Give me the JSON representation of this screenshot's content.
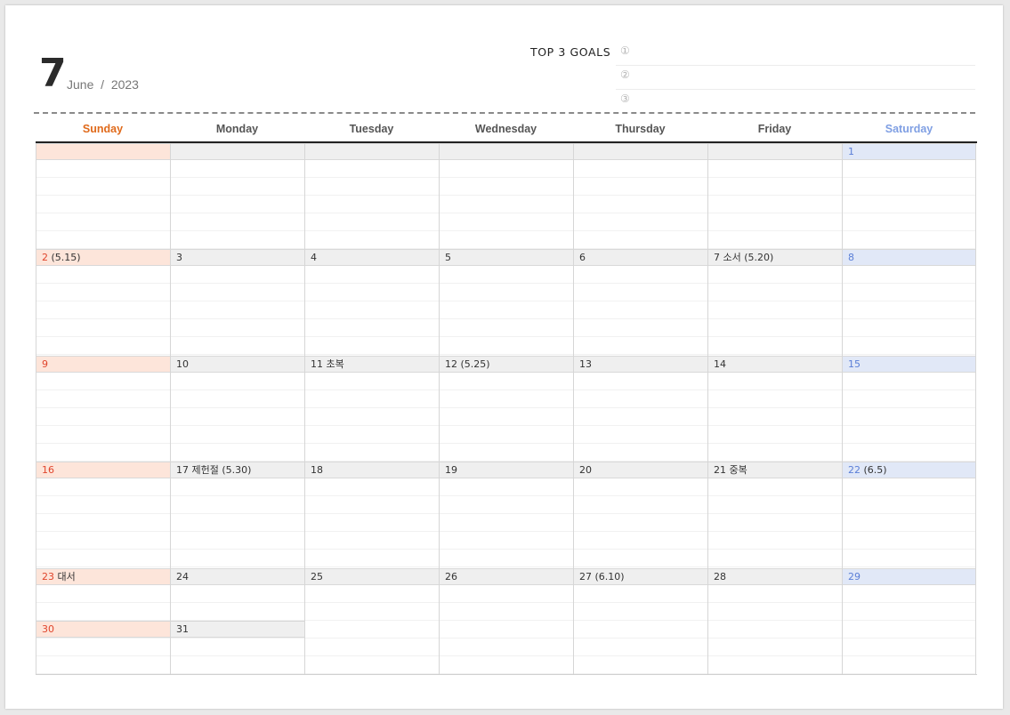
{
  "header": {
    "day_number": "7",
    "month": "June",
    "separator": "/",
    "year": "2023"
  },
  "goals": {
    "title": "TOP 3 GOALS",
    "markers": [
      "①",
      "②",
      "③"
    ]
  },
  "weekdays": [
    "Sunday",
    "Monday",
    "Tuesday",
    "Wednesday",
    "Thursday",
    "Friday",
    "Saturday"
  ],
  "colors": {
    "sunday_accent": "#e06a1b",
    "saturday_accent": "#7f9fe3",
    "holiday_red": "#e0452c",
    "saturday_blue": "#5b7fd7",
    "sunday_bar": "#fde5da",
    "saturday_bar": "#e1e8f7",
    "weekday_bar": "#efefef"
  },
  "weeks": [
    [
      {
        "day": "",
        "note": ""
      },
      {
        "day": "",
        "note": ""
      },
      {
        "day": "",
        "note": ""
      },
      {
        "day": "",
        "note": ""
      },
      {
        "day": "",
        "note": ""
      },
      {
        "day": "",
        "note": ""
      },
      {
        "day": "1",
        "note": ""
      }
    ],
    [
      {
        "day": "2",
        "note": "(5.15)"
      },
      {
        "day": "3",
        "note": ""
      },
      {
        "day": "4",
        "note": ""
      },
      {
        "day": "5",
        "note": ""
      },
      {
        "day": "6",
        "note": ""
      },
      {
        "day": "7",
        "note": "소서 (5.20)"
      },
      {
        "day": "8",
        "note": ""
      }
    ],
    [
      {
        "day": "9",
        "note": ""
      },
      {
        "day": "10",
        "note": ""
      },
      {
        "day": "11",
        "note": "초복"
      },
      {
        "day": "12",
        "note": "(5.25)"
      },
      {
        "day": "13",
        "note": ""
      },
      {
        "day": "14",
        "note": ""
      },
      {
        "day": "15",
        "note": ""
      }
    ],
    [
      {
        "day": "16",
        "note": ""
      },
      {
        "day": "17",
        "note": "제헌절 (5.30)"
      },
      {
        "day": "18",
        "note": ""
      },
      {
        "day": "19",
        "note": ""
      },
      {
        "day": "20",
        "note": ""
      },
      {
        "day": "21",
        "note": "중복"
      },
      {
        "day": "22",
        "note": "(6.5)"
      }
    ],
    [
      {
        "day": "23",
        "note": "대서",
        "extra": {
          "day": "30",
          "note": ""
        }
      },
      {
        "day": "24",
        "note": "",
        "extra": {
          "day": "31",
          "note": ""
        }
      },
      {
        "day": "25",
        "note": ""
      },
      {
        "day": "26",
        "note": ""
      },
      {
        "day": "27",
        "note": "(6.10)"
      },
      {
        "day": "28",
        "note": ""
      },
      {
        "day": "29",
        "note": ""
      }
    ]
  ]
}
